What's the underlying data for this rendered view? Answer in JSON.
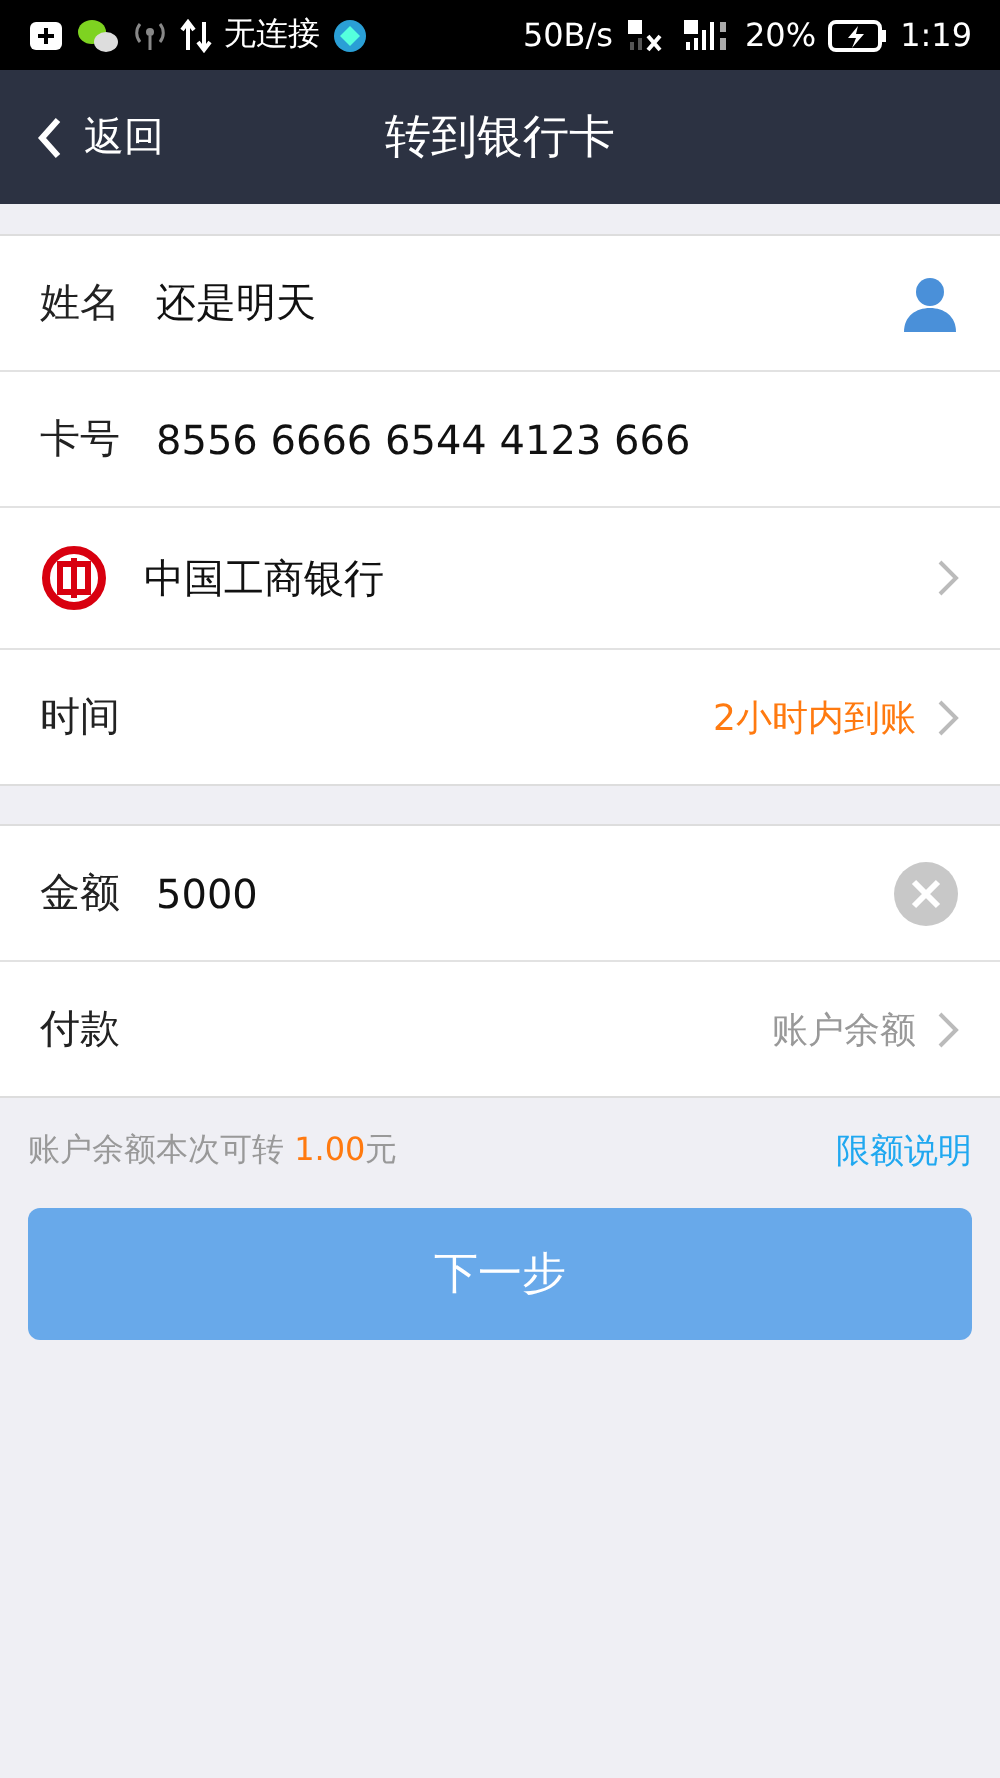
{
  "status_bar": {
    "notification": "无连接",
    "speed": "50B/s",
    "battery": "20%",
    "time": "1:19"
  },
  "header": {
    "back": "返回",
    "title": "转到银行卡"
  },
  "recipient_rows": [
    {
      "kind": "contact",
      "label": "姓名",
      "value": "还是明天"
    },
    {
      "kind": "text",
      "label": "卡号",
      "value": "8556 6666 6544 4123 666"
    },
    {
      "kind": "bank",
      "value": "中国工商银行"
    },
    {
      "kind": "option",
      "label": "时间",
      "value": "2小时内到账"
    }
  ],
  "payment_rows": [
    {
      "kind": "amount",
      "label": "金额",
      "value": "5000"
    },
    {
      "kind": "option",
      "label": "付款",
      "value": "账户余额"
    }
  ],
  "balance_note": {
    "prefix": "账户余额本次可转 ",
    "amount": "1.00",
    "suffix": "元",
    "link": "限额说明"
  },
  "next_button": "下一步"
}
